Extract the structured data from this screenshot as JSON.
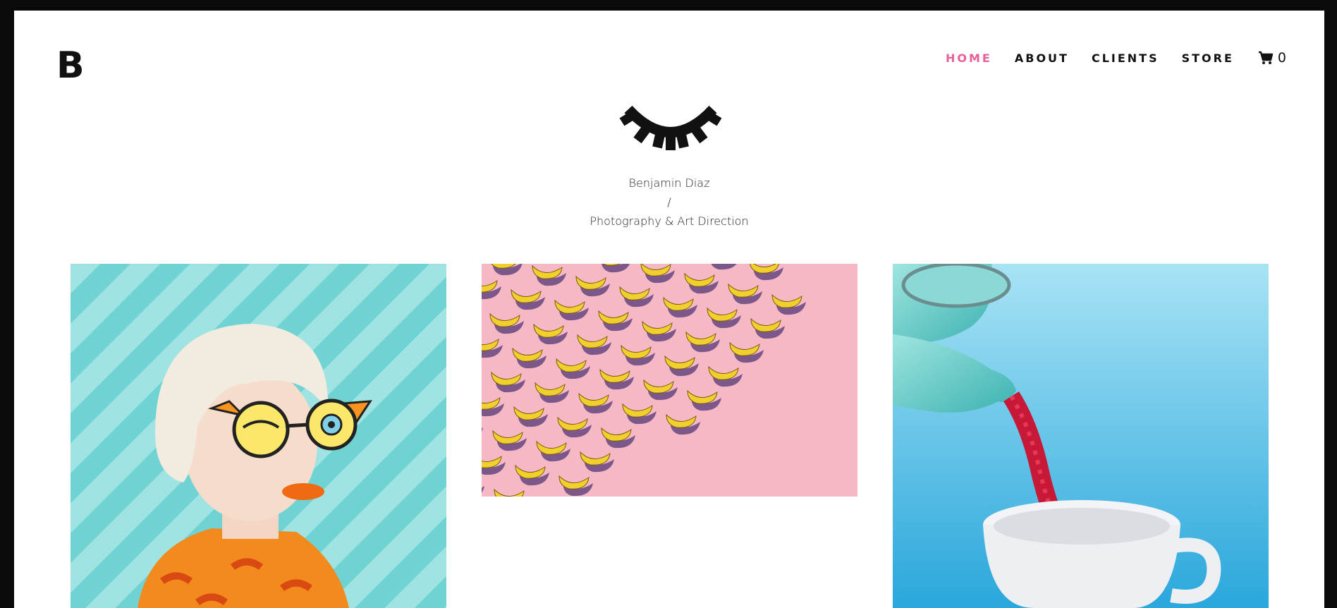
{
  "site": {
    "logo_letter": "B",
    "brand_icon": "closed-eye-lashes-icon"
  },
  "nav": {
    "items": [
      "HOME",
      "ABOUT",
      "CLIENTS",
      "STORE"
    ],
    "active": "HOME",
    "active_color": "#e6609a",
    "cart_icon": "shopping-cart-icon",
    "cart_count": "0"
  },
  "hero": {
    "name": "Benjamin Diaz",
    "separator": "/",
    "title": "Photography & Art Direction"
  },
  "gallery": {
    "tiles": [
      {
        "subject": "woman-with-cartoon-glasses",
        "background": "#6fd3d4"
      },
      {
        "subject": "bananas-on-pink",
        "background": "#f7b8c6"
      },
      {
        "subject": "teapot-pouring-licorice",
        "background": "#5cc3ec"
      }
    ]
  }
}
